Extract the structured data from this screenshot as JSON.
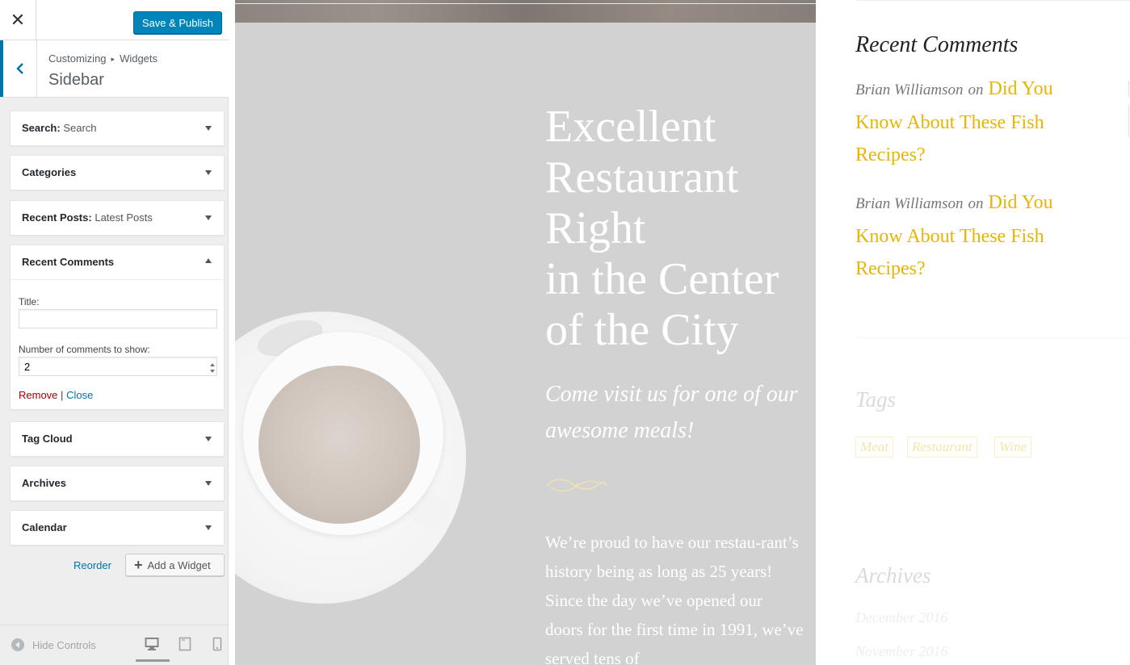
{
  "customizer": {
    "close_label": "✕",
    "save_label": "Save & Publish",
    "breadcrumb": {
      "root": "Customizing",
      "separator": "▸",
      "current": "Widgets"
    },
    "section_title": "Sidebar",
    "widgets": [
      {
        "title": "Search",
        "sep": ":",
        "subtitle": "Search"
      },
      {
        "title": "Categories"
      },
      {
        "title": "Recent Posts",
        "sep": ":",
        "subtitle": "Latest Posts"
      },
      {
        "title": "Recent Comments"
      },
      {
        "title": "Tag Cloud"
      },
      {
        "title": "Archives"
      },
      {
        "title": "Calendar"
      }
    ],
    "open_widget": {
      "title_label": "Title:",
      "title_value": "",
      "count_label": "Number of comments to show:",
      "count_value": "2",
      "remove_label": "Remove",
      "divider": "|",
      "close_label": "Close"
    },
    "reorder_label": "Reorder",
    "add_widget_label": "Add a Widget",
    "add_widget_icon": "+",
    "hide_controls_label": "Hide Controls",
    "colors": {
      "primary": "#0085ba",
      "link": "#0073aa",
      "remove": "#a00",
      "panel_bg": "#eeeeee"
    }
  },
  "preview": {
    "hero": {
      "title_lines": [
        "Excellent",
        "Restaurant",
        "Right",
        "in the Center",
        "of the City"
      ],
      "subtitle": "Come visit us for one of our awesome meals!",
      "body": "We’re proud to have our restau-rant’s history being as long as 25 years! Since the day we’ve opened our doors for the first time in 1991, we’ve served tens of"
    },
    "recent_comments": {
      "heading": "Recent Comments",
      "items": [
        {
          "author": "Brian Williamson",
          "on": "on",
          "post": "Did You Know About These Fish Recipes?"
        },
        {
          "author": "Brian Williamson",
          "on": "on",
          "post": "Did You Know About These Fish Recipes?"
        }
      ]
    },
    "tags": {
      "heading": "Tags",
      "items": [
        "Meat",
        "Restaurant",
        "Wine"
      ]
    },
    "archives": {
      "heading": "Archives",
      "items": [
        "December 2016",
        "November 2016"
      ]
    },
    "colors": {
      "accent": "#e8b600",
      "text": "#333333"
    }
  }
}
